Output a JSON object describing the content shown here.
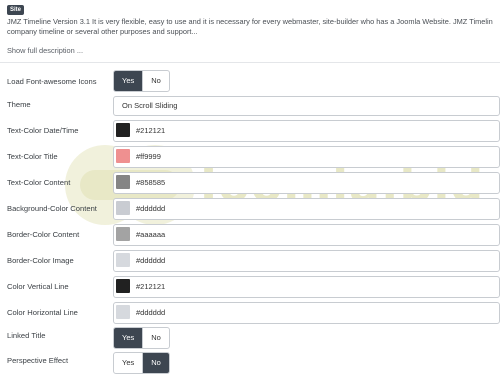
{
  "header": {
    "badge": "Site",
    "description_lines": [
      "JMZ Timeline Version 3.1 It is very flexible, easy to use and it is necessary for every webmaster, site-builder who has a Joomla Website. JMZ Timeline is mod",
      "company timeline or several other purposes and support..."
    ],
    "show_link": "Show full description ..."
  },
  "watermark": {
    "text": "Joomla.bld"
  },
  "fields": {
    "load_fontawesome": {
      "label": "Load Font-awesome Icons",
      "yes": "Yes",
      "no": "No",
      "value": "Yes"
    },
    "theme": {
      "label": "Theme",
      "value": "On Scroll Sliding"
    },
    "text_color_date": {
      "label": "Text-Color Date/Time",
      "value": "#212121",
      "swatch": "#212121"
    },
    "text_color_title": {
      "label": "Text-Color Title",
      "value": "#ff9999",
      "swatch": "#ef9090"
    },
    "text_color_content": {
      "label": "Text-Color Content",
      "value": "#858585",
      "swatch": "#858585"
    },
    "bg_color_content": {
      "label": "Background-Color Content",
      "value": "#dddddd",
      "swatch": "#c9ccd2"
    },
    "border_color_content": {
      "label": "Border-Color Content",
      "value": "#aaaaaa",
      "swatch": "#a3a3a3"
    },
    "border_color_image": {
      "label": "Border-Color Image",
      "value": "#dddddd",
      "swatch": "#d6d9de"
    },
    "color_vertical_line": {
      "label": "Color Vertical Line",
      "value": "#212121",
      "swatch": "#212121"
    },
    "color_horizontal_line": {
      "label": "Color Horizontal Line",
      "value": "#dddddd",
      "swatch": "#d6d9de"
    },
    "linked_title": {
      "label": "Linked Title",
      "yes": "Yes",
      "no": "No",
      "value": "Yes"
    },
    "perspective_effect": {
      "label": "Perspective Effect",
      "yes": "Yes",
      "no": "No",
      "value": "No"
    }
  }
}
